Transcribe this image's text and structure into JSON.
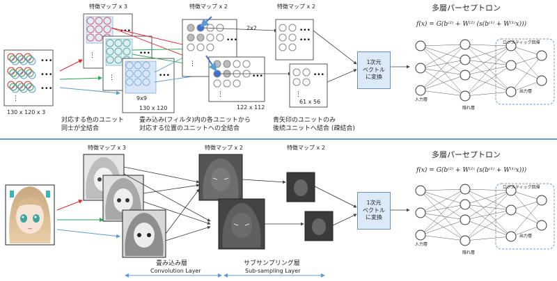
{
  "top": {
    "fmap3_label": "特徴マップ x 3",
    "fmap2a_label": "特徴マップ x 2",
    "fmap2b_label": "特徴マップ x 2",
    "mlp_title": "多層パーセプトロン",
    "formula": "f(x) = G(b⁽²⁾ + W⁽²⁾ (s(b⁽¹⁾ + W⁽¹⁾x)))",
    "input_size": "130 x 120 x 3",
    "conv_size": "130 x 120",
    "filter_size": "9x9",
    "map2_size": "122 x 112",
    "pool_size": "61 x 56",
    "pool_window": "2x2",
    "vector_label_1": "1次元",
    "vector_label_2": "ベクトル",
    "vector_label_3": "に変換",
    "caption_color_1": "対応する色のユニット",
    "caption_color_2": "同士が全結合",
    "caption_filter_1": "畳み込み(フィルタ)内の各ユニットから",
    "caption_filter_2": "対応する位置のユニットへの全結合",
    "caption_arrow_1": "青矢印のユニットのみ",
    "caption_arrow_2": "後続ユニットへ結合 (疎結合)",
    "input_layer": "入力層",
    "hidden_layer": "隠れ層",
    "output_layer": "出力層",
    "logistic_label": "ロジスティック回帰"
  },
  "bottom": {
    "fmap3_label": "特徴マップ x 3",
    "fmap2a_label": "特徴マップ x 2",
    "fmap2b_label": "特徴マップ x 2",
    "mlp_title": "多層パーセプトロン",
    "formula": "f(x) = G(b⁽²⁾ + W⁽²⁾ (s(b⁽¹⁾ + W⁽¹⁾x)))",
    "vector_label_1": "1次元",
    "vector_label_2": "ベクトル",
    "vector_label_3": "に変換",
    "conv_layer_jp": "畳み込み層",
    "conv_layer_en": "Convolution Layer",
    "sub_layer_jp": "サブサンプリング層",
    "sub_layer_en": "Sub-sampling Layer",
    "input_layer": "入力層",
    "hidden_layer": "隠れ層",
    "output_layer": "出力層",
    "logistic_label": "ロジスティック回帰"
  },
  "colors": {
    "red": "#e8262b",
    "green": "#22a84a",
    "blue": "#5b9bd5",
    "separator": "#5b9bd5",
    "highlight_blue": "#3f6fd0",
    "grey_unit": "#b0b0b0"
  }
}
